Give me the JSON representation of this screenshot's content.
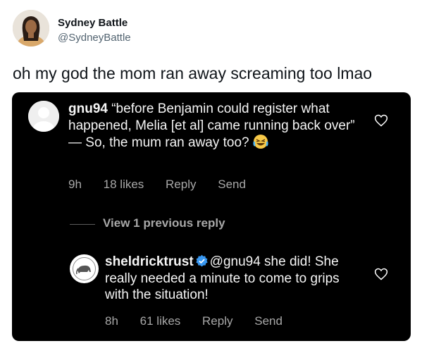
{
  "author": {
    "name": "Sydney Battle",
    "handle": "@SydneyBattle"
  },
  "tweet": {
    "text": "oh my god the mom ran away screaming too lmao"
  },
  "comments": [
    {
      "username": "gnu94",
      "text": "“before Benjamin could register what happened, Melia [et al] came running back over” — So, the mum ran away too?",
      "emoji": "face-with-tears-of-joy",
      "time": "9h",
      "likes": "18 likes",
      "reply_label": "Reply",
      "send_label": "Send"
    },
    {
      "username": "sheldricktrust",
      "verified": true,
      "mention": "@gnu94",
      "text": " she did! She really needed a minute to come to grips with the situation!",
      "time": "8h",
      "likes": "61 likes",
      "reply_label": "Reply",
      "send_label": "Send"
    }
  ],
  "view_previous": "View 1 previous reply",
  "colors": {
    "background": "#ffffff",
    "card": "#000000",
    "verified": "#3897f0",
    "meta": "#a8a8a8"
  }
}
